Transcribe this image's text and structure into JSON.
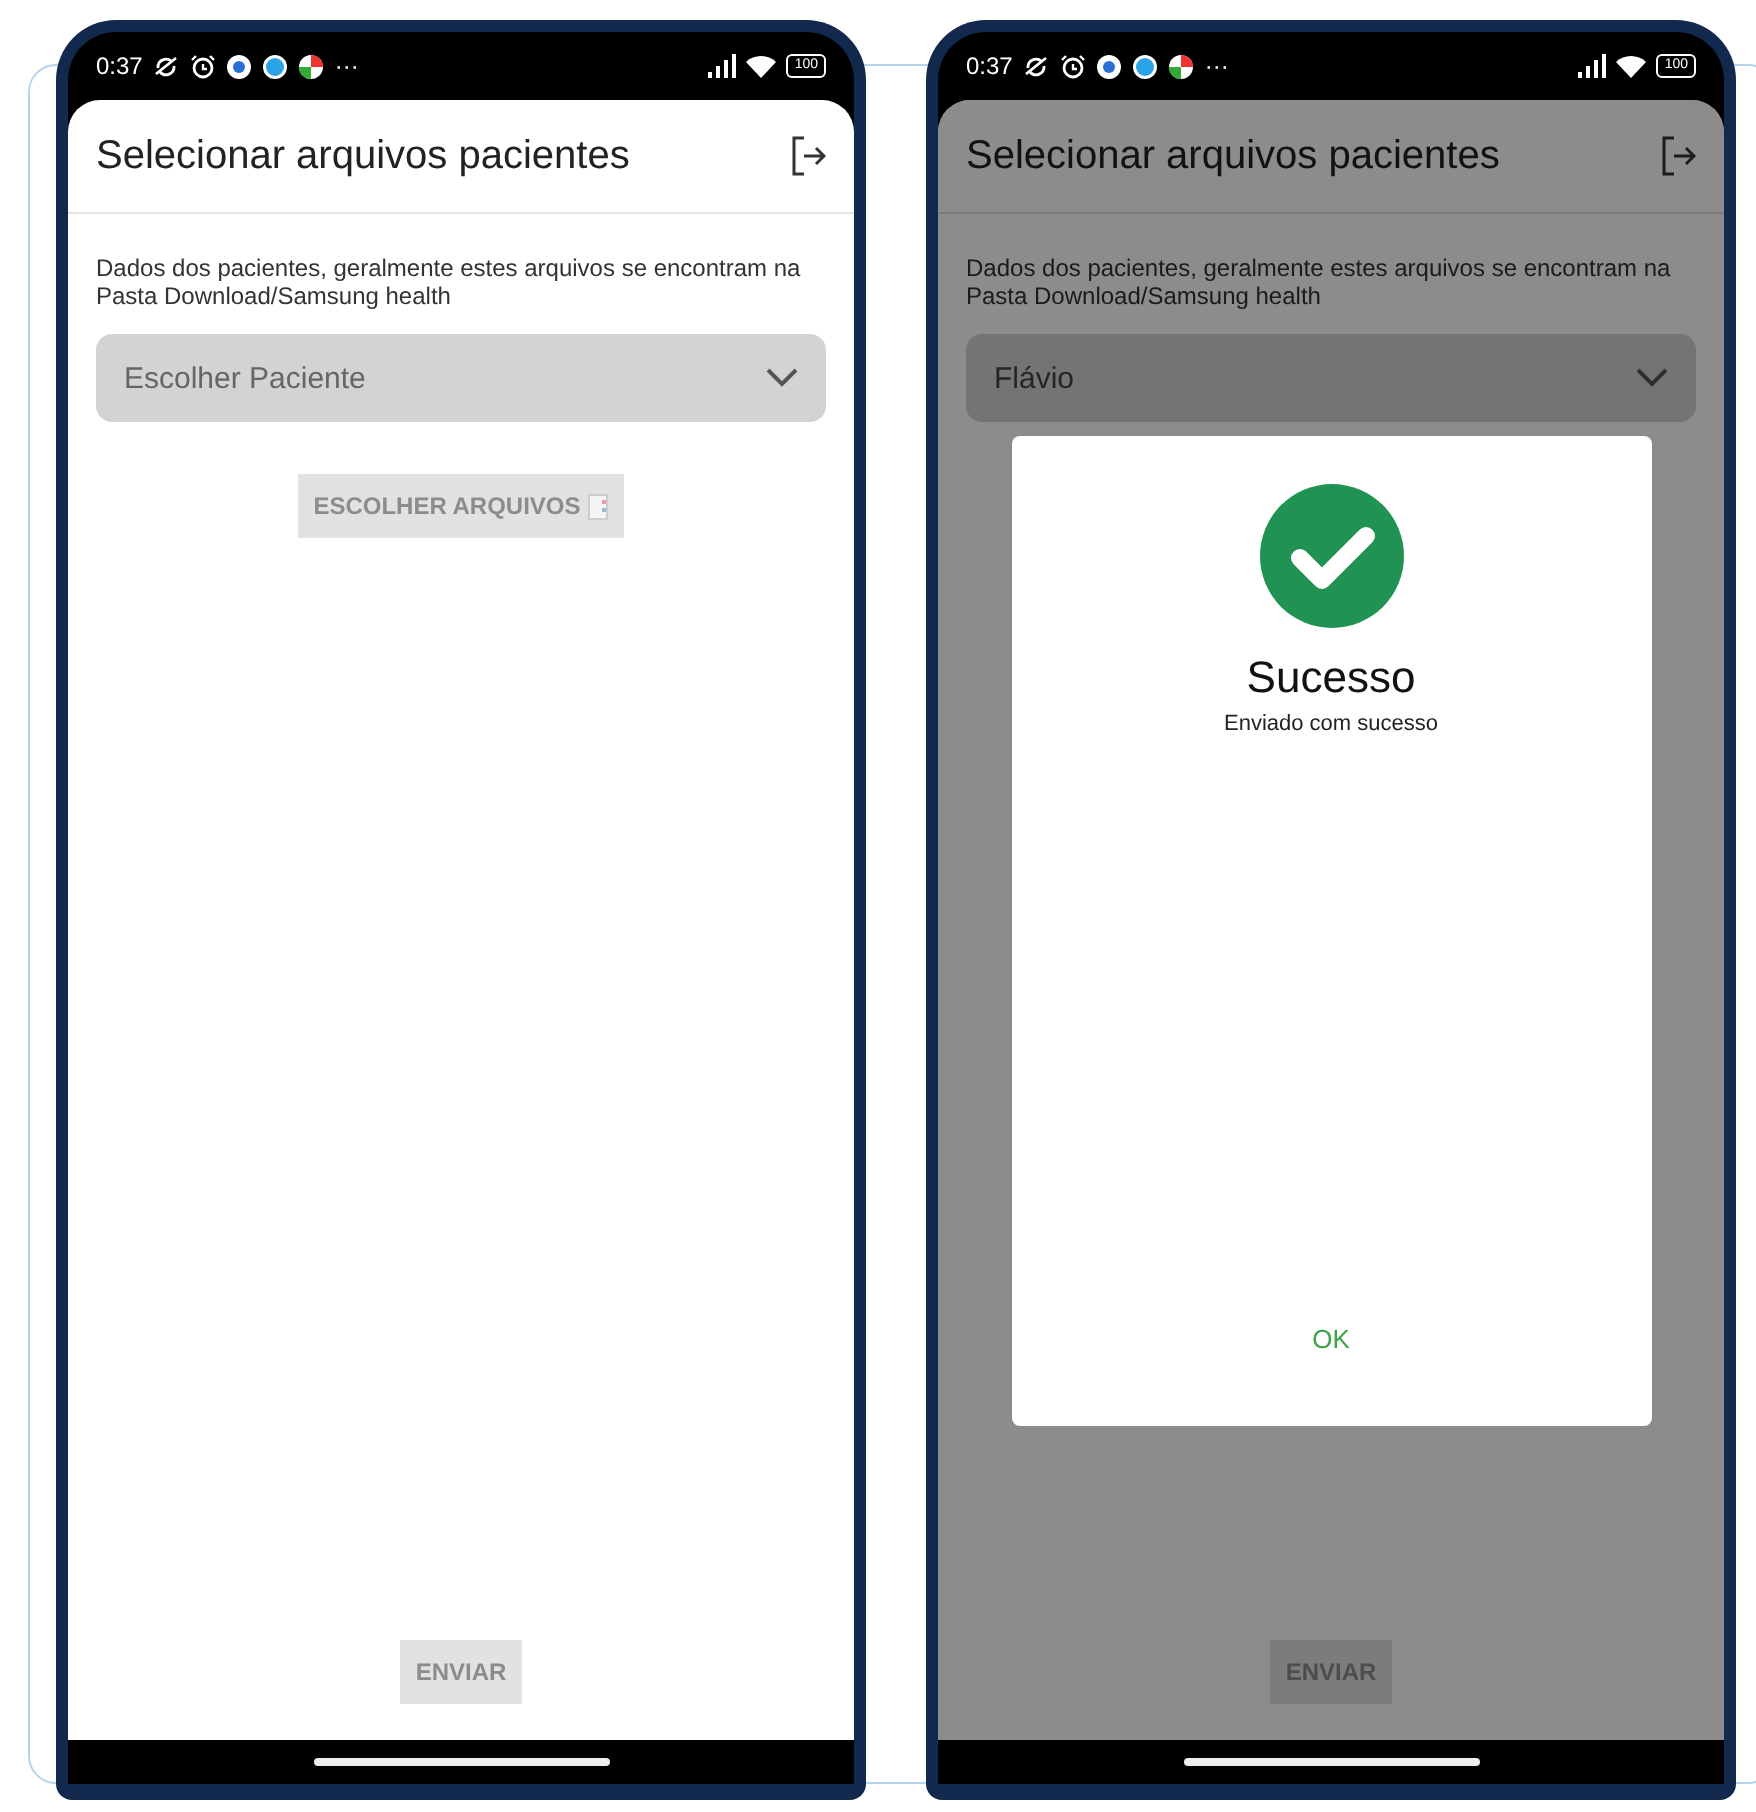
{
  "phones": [
    {
      "status_bar": {
        "time": "0:37",
        "more": "···",
        "battery": "100"
      },
      "title": "Selecionar arquivos pacientes",
      "description": "Dados dos pacientes, geralmente estes arquivos se encontram na Pasta Download/Samsung health",
      "patient_select": {
        "placeholder": "Escolher Paciente"
      },
      "choose_files_button": {
        "label": "ESCOLHER ARQUIVOS",
        "disabled": true
      },
      "send_button": {
        "label": "ENVIAR",
        "disabled": true
      }
    },
    {
      "status_bar": {
        "time": "0:37",
        "more": "···",
        "battery": "100"
      },
      "title": "Selecionar arquivos pacientes",
      "description": "Dados dos pacientes, geralmente estes arquivos se encontram na Pasta Download/Samsung health",
      "patient_select": {
        "value": "Flávio"
      },
      "send_button": {
        "label": "ENVIAR",
        "disabled": true
      },
      "dialog": {
        "title": "Sucesso",
        "message": "Enviado com sucesso",
        "ok": "OK"
      }
    }
  ]
}
